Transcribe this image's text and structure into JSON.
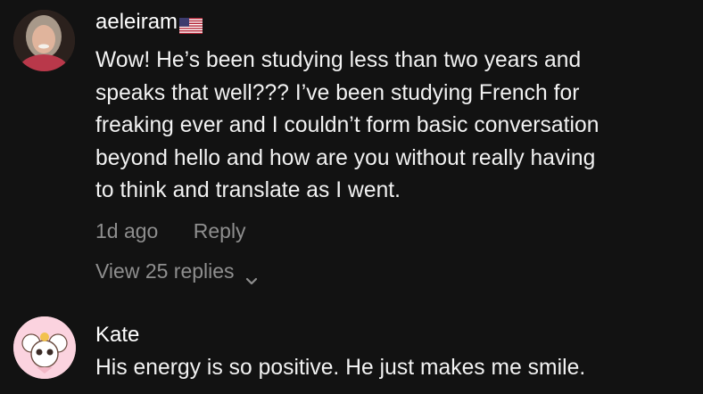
{
  "comments": [
    {
      "username": "aeleiram",
      "flag_icon": "us-flag-icon",
      "text_lines": [
        "Wow! He’s been studying less than two years and",
        "speaks that well??? I’ve been studying French for",
        "freaking ever and I couldn’t form basic conversation",
        "beyond hello and how are you without really having",
        "to think and translate as I went."
      ],
      "time": "1d ago",
      "reply_label": "Reply",
      "view_replies_label": "View 25 replies"
    },
    {
      "username": "Kate",
      "text_lines": [
        "His energy is so positive. He just makes me smile."
      ]
    }
  ],
  "colors": {
    "background": "#121212",
    "secondary_text": "#8e8e8e",
    "avatar2_bg": "#fbd3df"
  }
}
